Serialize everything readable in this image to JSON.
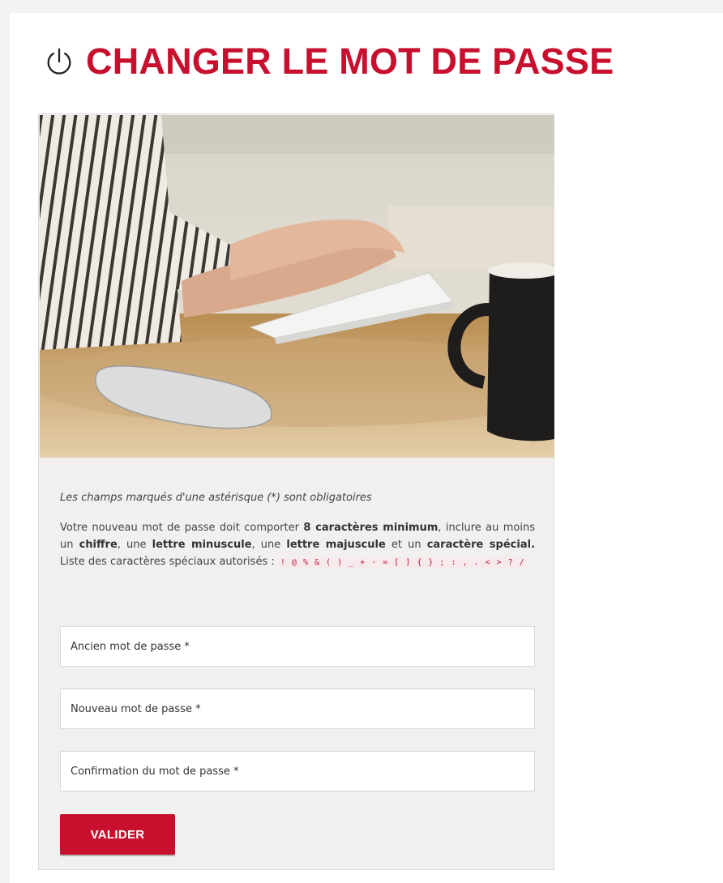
{
  "colors": {
    "accent": "#c8102e",
    "card_bg": "#f1f0ef",
    "page_bg": "#ffffff"
  },
  "header": {
    "icon": "power-icon",
    "title": "CHANGER LE MOT DE PASSE"
  },
  "image": {
    "alt": "photo-typing-on-keyboard"
  },
  "form": {
    "required_note": "Les champs marqués d'une astérisque (*) sont obligatoires",
    "rules": {
      "t1": "Votre nouveau mot de passe doit comporter ",
      "b1": "8 caractères minimum",
      "t2": ", inclure au moins un ",
      "b2": "chiffre",
      "t3": ", une ",
      "b3": "lettre minuscule",
      "t4": ", une ",
      "b4": "lettre majuscule",
      "t5": " et un ",
      "b5": "caractère spécial.",
      "t6": " Liste des caractères spéciaux autorisés : ",
      "special_chars": "! @ % & ( ) _ + - = [ ] { } ; : , . < > ? /"
    },
    "fields": [
      {
        "placeholder": "Ancien mot de passe *"
      },
      {
        "placeholder": "Nouveau mot de passe *"
      },
      {
        "placeholder": "Confirmation du mot de passe *"
      }
    ],
    "submit_label": "VALIDER"
  }
}
